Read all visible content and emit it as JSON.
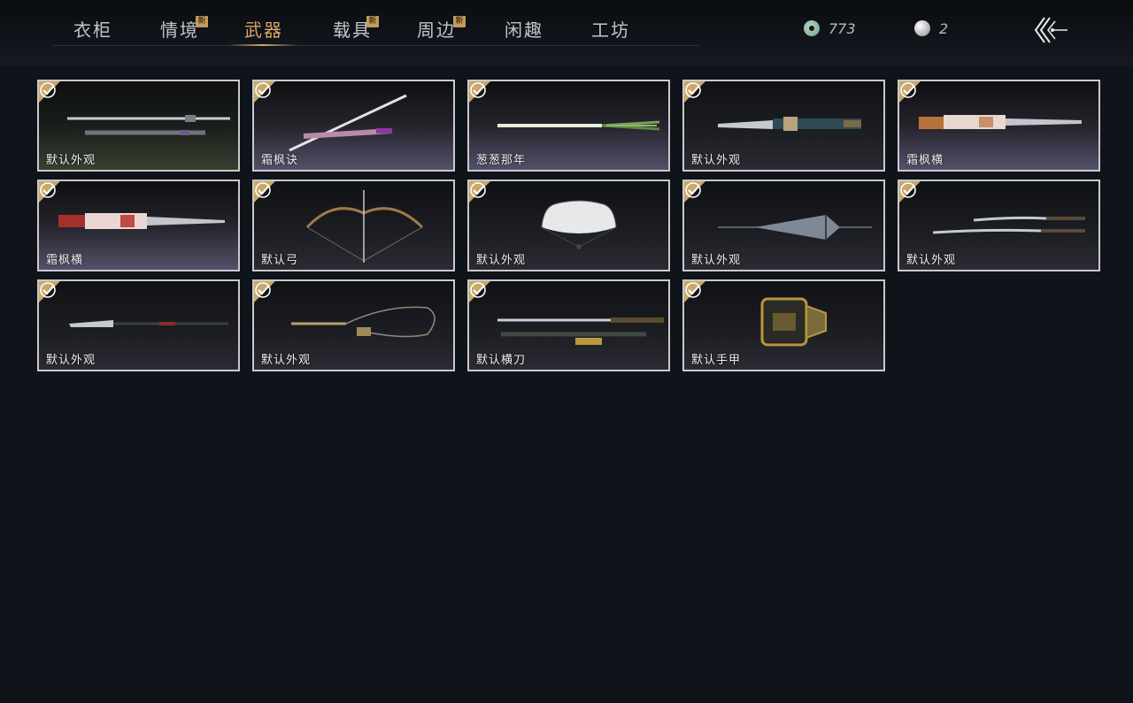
{
  "tabs": [
    {
      "label": "衣柜",
      "new": false,
      "active": false
    },
    {
      "label": "情境",
      "new": true,
      "active": false
    },
    {
      "label": "武器",
      "new": false,
      "active": true
    },
    {
      "label": "载具",
      "new": true,
      "active": false
    },
    {
      "label": "周边",
      "new": true,
      "active": false
    },
    {
      "label": "闲趣",
      "new": false,
      "active": false
    },
    {
      "label": "工坊",
      "new": false,
      "active": false
    }
  ],
  "new_badge": "新",
  "currency": {
    "jade": {
      "icon": "jade-coin-icon",
      "amount": "773"
    },
    "pearl": {
      "icon": "pearl-icon",
      "amount": "2"
    }
  },
  "colors": {
    "accent": "#d9a766",
    "badge": "#c69a5b",
    "background": "#0f131a"
  },
  "items": [
    {
      "name": "默认外观",
      "icon": "sword-and-scabbard-icon",
      "owned": true
    },
    {
      "name": "霜枫诀",
      "icon": "sword-with-pink-scabbard-icon",
      "owned": true
    },
    {
      "name": "葱葱那年",
      "icon": "green-onion-icon",
      "owned": true
    },
    {
      "name": "默认外观",
      "icon": "ornate-blade-icon",
      "owned": true
    },
    {
      "name": "霜枫横",
      "icon": "blade-with-red-handle-icon",
      "owned": true
    },
    {
      "name": "霜枫横",
      "icon": "blade-with-red-handle-icon",
      "owned": true
    },
    {
      "name": "默认弓",
      "icon": "bow-icon",
      "owned": true
    },
    {
      "name": "默认外观",
      "icon": "folding-fan-icon",
      "owned": true
    },
    {
      "name": "默认外观",
      "icon": "umbrella-icon",
      "owned": true
    },
    {
      "name": "默认外观",
      "icon": "twin-sabres-icon",
      "owned": true
    },
    {
      "name": "默认外观",
      "icon": "glaive-icon",
      "owned": true
    },
    {
      "name": "默认外观",
      "icon": "rope-dart-icon",
      "owned": true
    },
    {
      "name": "默认横刀",
      "icon": "hengdao-icon",
      "owned": true
    },
    {
      "name": "默认手甲",
      "icon": "gauntlet-icon",
      "owned": true
    }
  ]
}
